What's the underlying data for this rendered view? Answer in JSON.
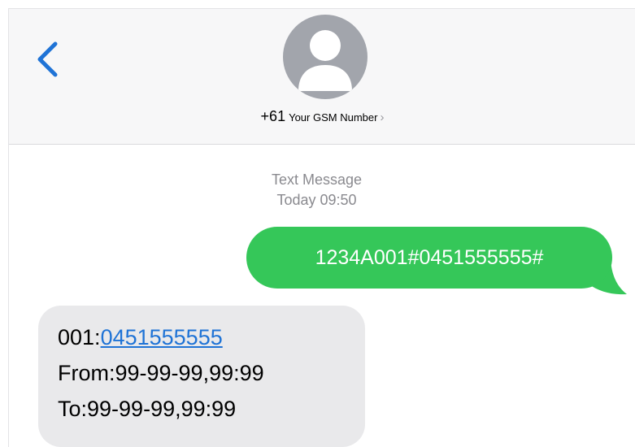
{
  "header": {
    "back_icon": "chevron-left-icon",
    "avatar_icon": "person-silhouette-icon",
    "contact_country_code": "+61",
    "contact_name": "Your GSM Number",
    "contact_chevron": "›"
  },
  "thread": {
    "service_label": "Text Message",
    "time_label": "Today 09:50"
  },
  "messages": {
    "sent": {
      "text": "1234A001#0451555555#"
    },
    "received": {
      "line1_prefix": "001:",
      "line1_link": "0451555555",
      "line2": "From:99-99-99,99:99",
      "line3": "To:99-99-99,99:99"
    }
  },
  "colors": {
    "sent_bubble": "#35c759",
    "received_bubble": "#e9e9eb",
    "accent_blue": "#1f73d6",
    "header_background": "#f7f7f8",
    "avatar": "#a2a5ac",
    "timestamp_text": "#8a8a8f"
  }
}
